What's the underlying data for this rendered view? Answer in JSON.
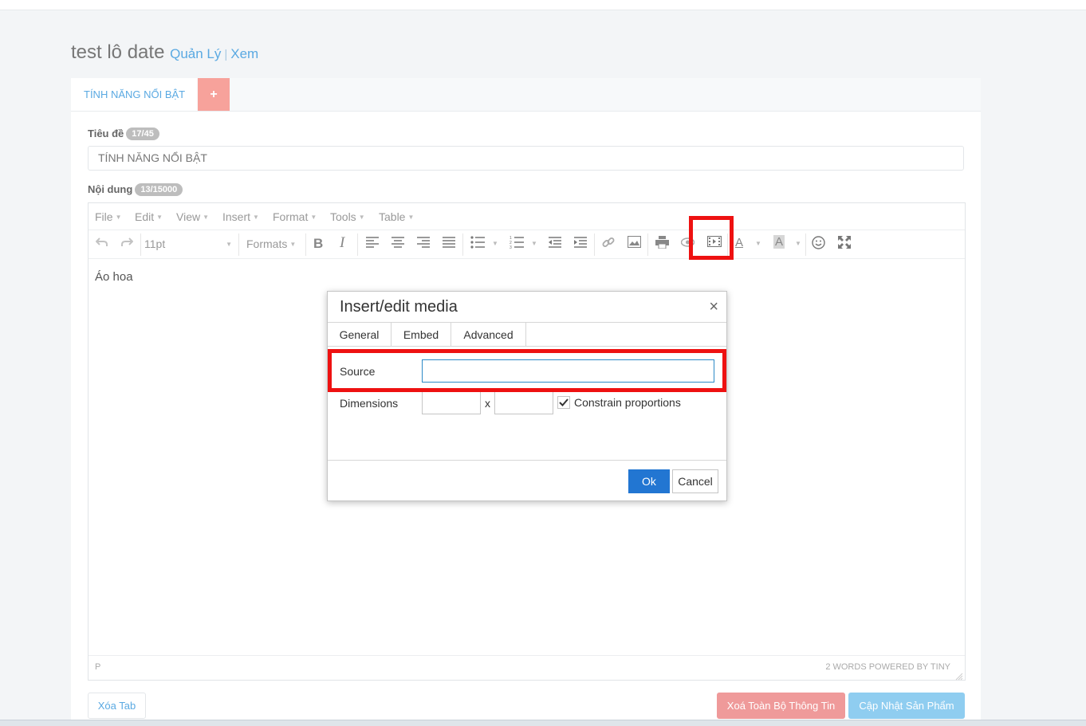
{
  "header": {
    "title": "test lô date",
    "manage_link": "Quản Lý",
    "separator": "|",
    "view_link": "Xem"
  },
  "tabs": {
    "active_label": "TÍNH NĂNG NỔI BẬT",
    "add_label": "+"
  },
  "form": {
    "title_label": "Tiêu đề",
    "title_count": "17/45",
    "title_value": "TÍNH NĂNG NỔI BẬT",
    "content_label": "Nội dung",
    "content_count": "13/15000"
  },
  "editor": {
    "menu": [
      "File",
      "Edit",
      "View",
      "Insert",
      "Format",
      "Tools",
      "Table"
    ],
    "font_size": "11pt",
    "formats_label": "Formats",
    "content": "Áo hoa",
    "status_path": "P",
    "word_count": "2 WORDS POWERED BY TINY",
    "icons": [
      "undo-icon",
      "redo-icon",
      "bold-icon",
      "italic-icon",
      "align-left-icon",
      "align-center-icon",
      "align-right-icon",
      "align-justify-icon",
      "bullet-list-icon",
      "numbered-list-icon",
      "outdent-icon",
      "indent-icon",
      "link-icon",
      "image-icon",
      "print-icon",
      "preview-icon",
      "media-icon",
      "text-color-icon",
      "background-color-icon",
      "emoticons-icon",
      "fullscreen-icon"
    ]
  },
  "actions": {
    "delete_tab": "Xóa Tab",
    "delete_all": "Xoá Toàn Bộ Thông Tin",
    "update": "Cập Nhật Sản Phẩm"
  },
  "dialog": {
    "title": "Insert/edit media",
    "close": "×",
    "tabs": [
      "General",
      "Embed",
      "Advanced"
    ],
    "source_label": "Source",
    "source_value": "",
    "dimensions_label": "Dimensions",
    "width_value": "",
    "height_value": "",
    "dim_separator": "x",
    "constrain_checked": true,
    "constrain_label": "Constrain proportions",
    "ok": "Ok",
    "cancel": "Cancel"
  },
  "colors": {
    "accent": "#5aa9e2",
    "highlight": "#ee1111",
    "ok_button": "#2276d2",
    "delete_all_button": "#ef9a9a",
    "update_button": "#8fcdf0",
    "add_tab_button": "#f7a29b"
  }
}
